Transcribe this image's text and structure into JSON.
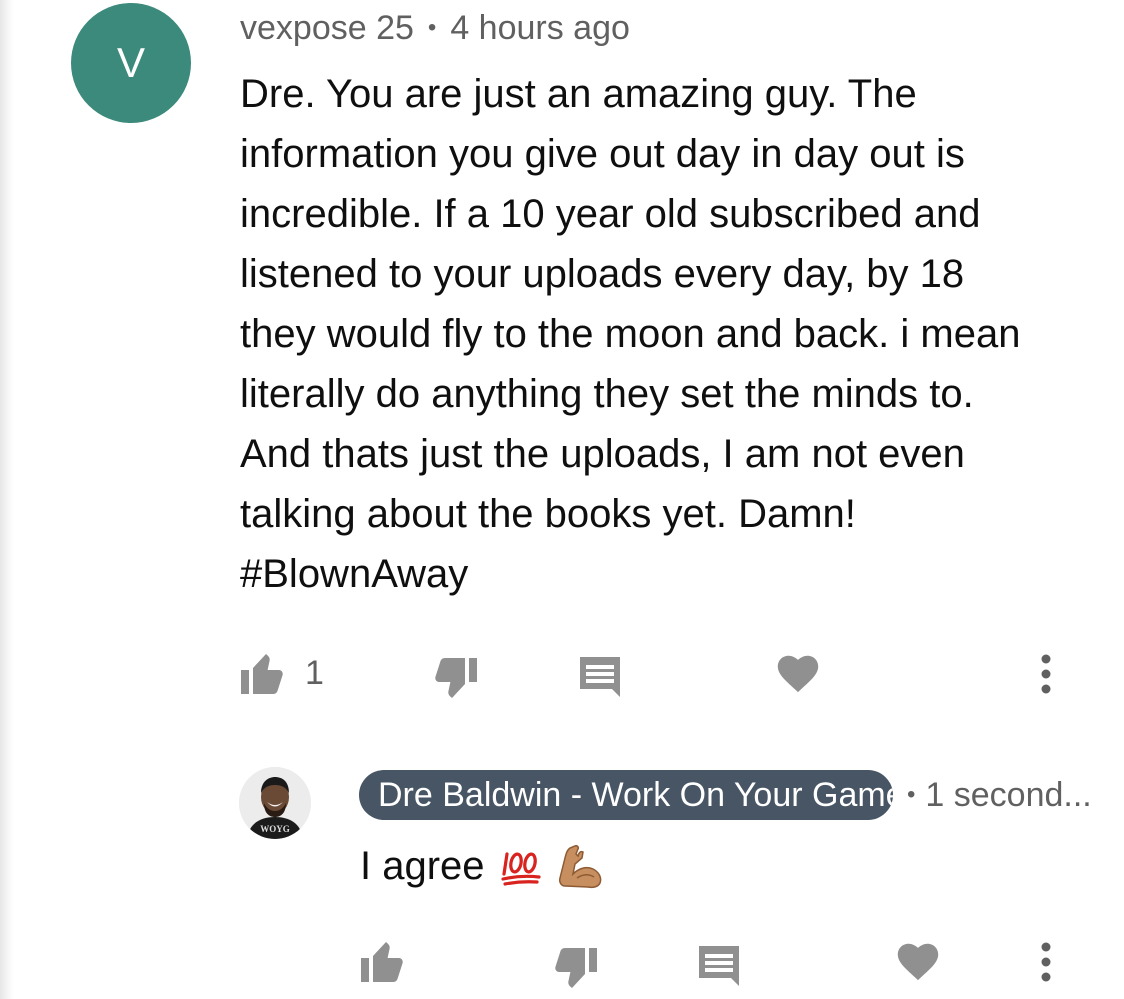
{
  "comment": {
    "avatar_letter": "V",
    "author": "vexpose 25",
    "separator": "•",
    "time": "4 hours ago",
    "text": "Dre. You are just an amazing guy. The information you give out day in day out is incredible. If a 10 year old subscribed and listened to your uploads every day, by 18 they would fly to the moon and back. i mean literally do anything they set the minds to. And thats just the uploads, I am not even talking about the books yet. Damn! #BlownAway",
    "like_count": "1",
    "actions": {
      "like_icon": "thumb-up-icon",
      "dislike_icon": "thumb-down-icon",
      "reply_icon": "comment-icon",
      "heart_icon": "heart-icon",
      "more_icon": "more-vertical-icon"
    }
  },
  "reply": {
    "author": "Dre Baldwin - Work On Your Game",
    "separator": "•",
    "time": "1 second...",
    "text": "I agree",
    "emojis": [
      "hundred-points-emoji",
      "flexed-biceps-emoji"
    ],
    "avatar_shirt_text": "WOYG"
  },
  "colors": {
    "avatar_bg": "#3b8a7b",
    "author_chip_bg": "#475564",
    "icon_gray": "#909090",
    "meta_gray": "#606060"
  }
}
